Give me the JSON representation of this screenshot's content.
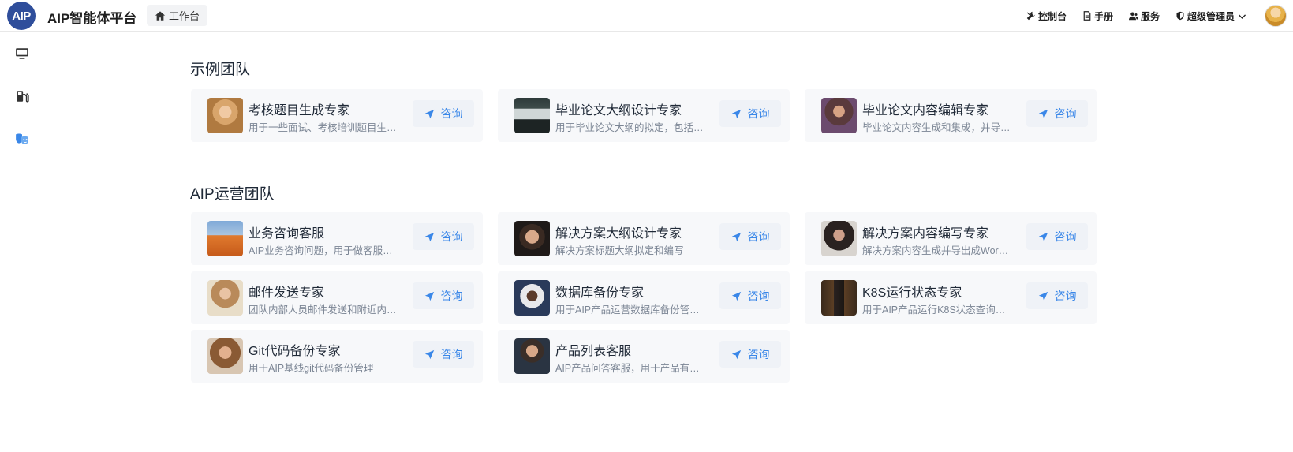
{
  "header": {
    "logo_text": "AIP",
    "app_title": "AIP智能体平台",
    "home_tab_label": "工作台",
    "nav": {
      "console_label": "控制台",
      "manual_label": "手册",
      "service_label": "服务",
      "admin_label": "超级管理员"
    }
  },
  "sections": {
    "example": {
      "title": "示例团队",
      "cards": [
        {
          "name": "考核题目生成专家",
          "desc": "用于一些面试、考核培训题目生…",
          "button": "咨询"
        },
        {
          "name": "毕业论文大纲设计专家",
          "desc": "用于毕业论文大纲的拟定，包括…",
          "button": "咨询"
        },
        {
          "name": "毕业论文内容编辑专家",
          "desc": "毕业论文内容生成和集成，并导…",
          "button": "咨询"
        }
      ]
    },
    "ops": {
      "title": "AIP运营团队",
      "cards": [
        {
          "name": "业务咨询客服",
          "desc": "AIP业务咨询问题，用于做客服…",
          "button": "咨询"
        },
        {
          "name": "解决方案大纲设计专家",
          "desc": "解决方案标题大纲拟定和编写",
          "button": "咨询"
        },
        {
          "name": "解决方案内容编写专家",
          "desc": "解决方案内容生成并导出成Wor…",
          "button": "咨询"
        },
        {
          "name": "邮件发送专家",
          "desc": "团队内部人员邮件发送和附近内…",
          "button": "咨询"
        },
        {
          "name": "数据库备份专家",
          "desc": "用于AIP产品运营数据库备份管…",
          "button": "咨询"
        },
        {
          "name": "K8S运行状态专家",
          "desc": "用于AIP产品运行K8S状态查询…",
          "button": "咨询"
        },
        {
          "name": "Git代码备份专家",
          "desc": "用于AIP基线git代码备份管理",
          "button": "咨询"
        },
        {
          "name": "产品列表客服",
          "desc": "AIP产品问答客服，用于产品有…",
          "button": "咨询"
        }
      ]
    }
  },
  "colors": {
    "accent": "#3a87e8",
    "logo_bg": "#2f4e9b",
    "card_bg": "#f7f8fa",
    "button_bg": "#eff2f7"
  },
  "icons": {
    "sidebar": [
      "monitor-icon",
      "fuel-station-icon",
      "theater-masks-icon"
    ],
    "button": "send-icon"
  }
}
